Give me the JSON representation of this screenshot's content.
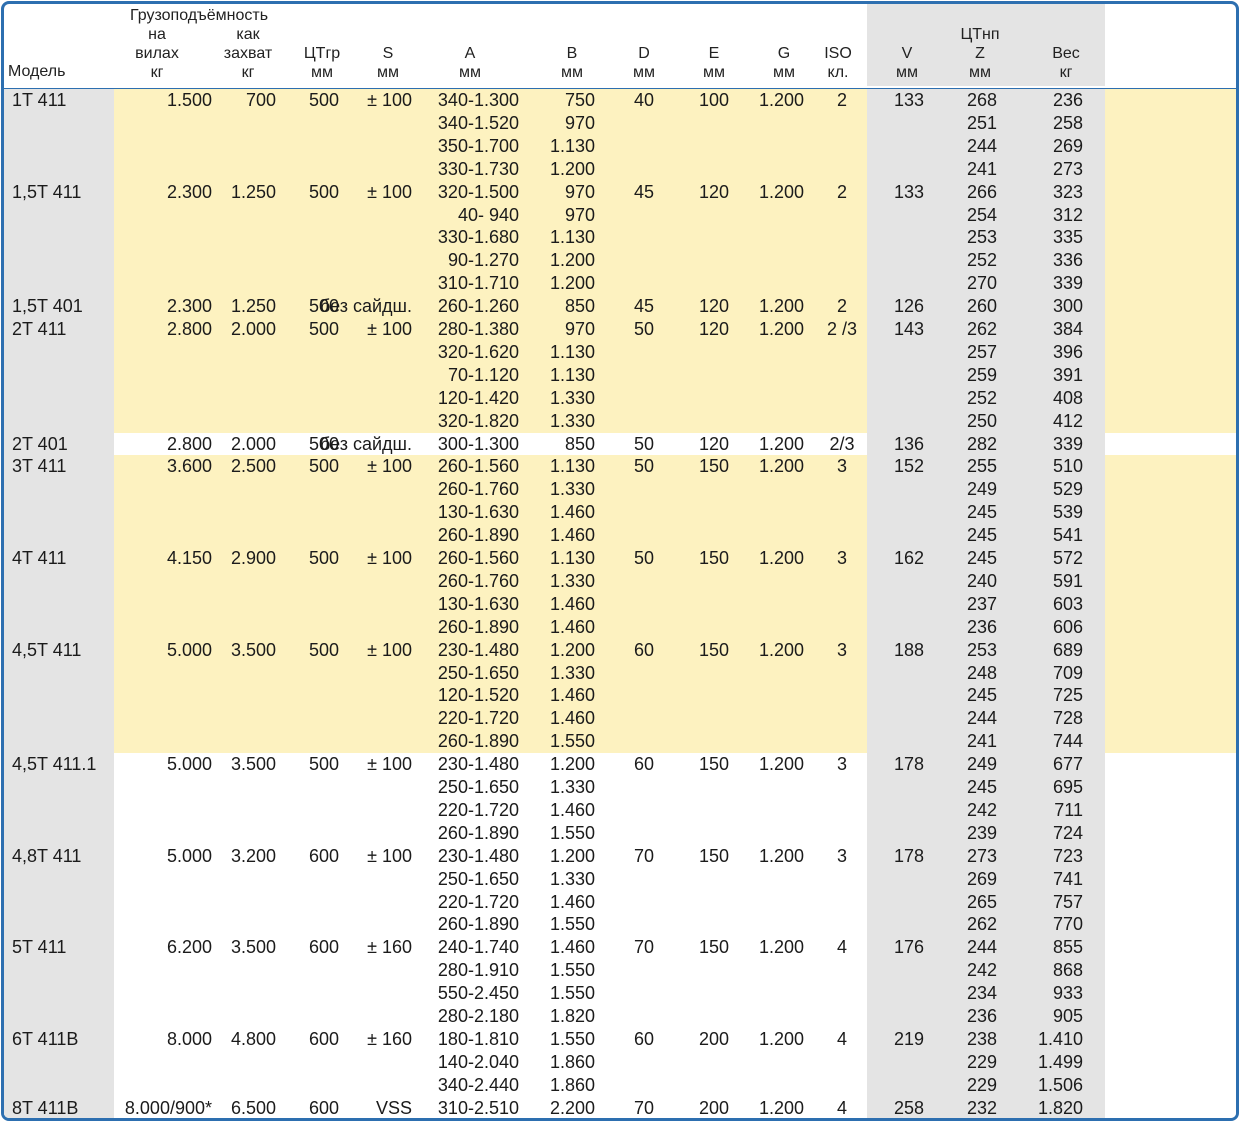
{
  "headers": {
    "model": "Модель",
    "capacity_group": "Грузоподъёмность",
    "forks": [
      "на",
      "вилах",
      "кг"
    ],
    "clamp": [
      "как",
      "захват",
      "кг"
    ],
    "ctgr": [
      "ЦТгр",
      "мм"
    ],
    "s": [
      "S",
      "мм"
    ],
    "a": [
      "A",
      "мм"
    ],
    "b": [
      "B",
      "мм"
    ],
    "d": [
      "D",
      "мм"
    ],
    "e": [
      "E",
      "мм"
    ],
    "g": [
      "G",
      "мм"
    ],
    "iso": [
      "ISO",
      "кл."
    ],
    "v": [
      "V",
      "мм"
    ],
    "z": [
      "ЦТнп",
      "Z",
      "мм"
    ],
    "weight": [
      "Вес",
      "кг"
    ]
  },
  "groups": [
    {
      "bg": "yellow",
      "rows": [
        {
          "model": "1T 411",
          "forks": "1.500",
          "clamp": "700",
          "ctgr": "500",
          "s": "± 100",
          "a": "340-1.300",
          "b": "750",
          "d": "40",
          "e": "100",
          "g": "1.200",
          "iso": "2",
          "v": "133",
          "z": "268",
          "w": "236"
        },
        {
          "a": "340-1.520",
          "b": "970",
          "z": "251",
          "w": "258"
        },
        {
          "a": "350-1.700",
          "b": "1.130",
          "z": "244",
          "w": "269"
        },
        {
          "a": "330-1.730",
          "b": "1.200",
          "z": "241",
          "w": "273"
        }
      ]
    },
    {
      "bg": "yellow",
      "rows": [
        {
          "model": "1,5T 411",
          "forks": "2.300",
          "clamp": "1.250",
          "ctgr": "500",
          "s": "± 100",
          "a": "320-1.500",
          "b": "970",
          "d": "45",
          "e": "120",
          "g": "1.200",
          "iso": "2",
          "v": "133",
          "z": "266",
          "w": "323"
        },
        {
          "a": "40- 940",
          "b": "970",
          "z": "254",
          "w": "312"
        },
        {
          "a": "330-1.680",
          "b": "1.130",
          "z": "253",
          "w": "335"
        },
        {
          "a": "90-1.270",
          "b": "1.200",
          "z": "252",
          "w": "336"
        },
        {
          "a": "310-1.710",
          "b": "1.200",
          "z": "270",
          "w": "339"
        },
        {
          "model": "1,5T 401",
          "forks": "2.300",
          "clamp": "1.250",
          "ctgr": "500",
          "s": "без сайдш.",
          "a": "260-1.260",
          "b": "850",
          "d": "45",
          "e": "120",
          "g": "1.200",
          "iso": "2",
          "v": "126",
          "z": "260",
          "w": "300"
        }
      ]
    },
    {
      "bg": "yellow",
      "rows": [
        {
          "model": "2T 411",
          "forks": "2.800",
          "clamp": "2.000",
          "ctgr": "500",
          "s": "± 100",
          "a": "280-1.380",
          "b": "970",
          "d": "50",
          "e": "120",
          "g": "1.200",
          "iso": "2 /3",
          "v": "143",
          "z": "262",
          "w": "384"
        },
        {
          "a": "320-1.620",
          "b": "1.130",
          "z": "257",
          "w": "396"
        },
        {
          "a": "70-1.120",
          "b": "1.130",
          "z": "259",
          "w": "391"
        },
        {
          "a": "120-1.420",
          "b": "1.330",
          "z": "252",
          "w": "408"
        },
        {
          "a": "320-1.820",
          "b": "1.330",
          "z": "250",
          "w": "412"
        }
      ]
    },
    {
      "bg": "white",
      "rows": [
        {
          "model": "2T 401",
          "forks": "2.800",
          "clamp": "2.000",
          "ctgr": "500",
          "s": "без сайдш.",
          "a": "300-1.300",
          "b": "850",
          "d": "50",
          "e": "120",
          "g": "1.200",
          "iso": "2/3",
          "v": "136",
          "z": "282",
          "w": "339"
        }
      ]
    },
    {
      "bg": "yellow",
      "rows": [
        {
          "model": "3T 411",
          "forks": "3.600",
          "clamp": "2.500",
          "ctgr": "500",
          "s": "± 100",
          "a": "260-1.560",
          "b": "1.130",
          "d": "50",
          "e": "150",
          "g": "1.200",
          "iso": "3",
          "v": "152",
          "z": "255",
          "w": "510"
        },
        {
          "a": "260-1.760",
          "b": "1.330",
          "z": "249",
          "w": "529"
        },
        {
          "a": "130-1.630",
          "b": "1.460",
          "z": "245",
          "w": "539"
        },
        {
          "a": "260-1.890",
          "b": "1.460",
          "z": "245",
          "w": "541"
        }
      ]
    },
    {
      "bg": "yellow",
      "rows": [
        {
          "model": "4T 411",
          "forks": "4.150",
          "clamp": "2.900",
          "ctgr": "500",
          "s": "± 100",
          "a": "260-1.560",
          "b": "1.130",
          "d": "50",
          "e": "150",
          "g": "1.200",
          "iso": "3",
          "v": "162",
          "z": "245",
          "w": "572"
        },
        {
          "a": "260-1.760",
          "b": "1.330",
          "z": "240",
          "w": "591"
        },
        {
          "a": "130-1.630",
          "b": "1.460",
          "z": "237",
          "w": "603"
        },
        {
          "a": "260-1.890",
          "b": "1.460",
          "z": "236",
          "w": "606"
        }
      ]
    },
    {
      "bg": "yellow",
      "rows": [
        {
          "model": "4,5T 411",
          "forks": "5.000",
          "clamp": "3.500",
          "ctgr": "500",
          "s": "± 100",
          "a": "230-1.480",
          "b": "1.200",
          "d": "60",
          "e": "150",
          "g": "1.200",
          "iso": "3",
          "v": "188",
          "z": "253",
          "w": "689"
        },
        {
          "a": "250-1.650",
          "b": "1.330",
          "z": "248",
          "w": "709"
        },
        {
          "a": "120-1.520",
          "b": "1.460",
          "z": "245",
          "w": "725"
        },
        {
          "a": "220-1.720",
          "b": "1.460",
          "z": "244",
          "w": "728"
        },
        {
          "a": "260-1.890",
          "b": "1.550",
          "z": "241",
          "w": "744"
        }
      ]
    },
    {
      "bg": "white",
      "rows": [
        {
          "model": "4,5T 411.1",
          "forks": "5.000",
          "clamp": "3.500",
          "ctgr": "500",
          "s": "± 100",
          "a": "230-1.480",
          "b": "1.200",
          "d": "60",
          "e": "150",
          "g": "1.200",
          "iso": "3",
          "v": "178",
          "z": "249",
          "w": "677"
        },
        {
          "a": "250-1.650",
          "b": "1.330",
          "z": "245",
          "w": "695"
        },
        {
          "a": "220-1.720",
          "b": "1.460",
          "z": "242",
          "w": "711"
        },
        {
          "a": "260-1.890",
          "b": "1.550",
          "z": "239",
          "w": "724"
        }
      ]
    },
    {
      "bg": "white",
      "rows": [
        {
          "model": "4,8T 411",
          "forks": "5.000",
          "clamp": "3.200",
          "ctgr": "600",
          "s": "± 100",
          "a": "230-1.480",
          "b": "1.200",
          "d": "70",
          "e": "150",
          "g": "1.200",
          "iso": "3",
          "v": "178",
          "z": "273",
          "w": "723"
        },
        {
          "a": "250-1.650",
          "b": "1.330",
          "z": "269",
          "w": "741"
        },
        {
          "a": "220-1.720",
          "b": "1.460",
          "z": "265",
          "w": "757"
        },
        {
          "a": "260-1.890",
          "b": "1.550",
          "z": "262",
          "w": "770"
        }
      ]
    },
    {
      "bg": "white",
      "rows": [
        {
          "model": "5T 411",
          "forks": "6.200",
          "clamp": "3.500",
          "ctgr": "600",
          "s": "± 160",
          "a": "240-1.740",
          "b": "1.460",
          "d": "70",
          "e": "150",
          "g": "1.200",
          "iso": "4",
          "v": "176",
          "z": "244",
          "w": "855"
        },
        {
          "a": "280-1.910",
          "b": "1.550",
          "z": "242",
          "w": "868"
        },
        {
          "a": "550-2.450",
          "b": "1.550",
          "z": "234",
          "w": "933"
        },
        {
          "a": "280-2.180",
          "b": "1.820",
          "z": "236",
          "w": "905"
        }
      ]
    },
    {
      "bg": "white",
      "rows": [
        {
          "model": "6T 411B",
          "forks": "8.000",
          "clamp": "4.800",
          "ctgr": "600",
          "s": "± 160",
          "a": "180-1.810",
          "b": "1.550",
          "d": "60",
          "e": "200",
          "g": "1.200",
          "iso": "4",
          "v": "219",
          "z": "238",
          "w": "1.410"
        },
        {
          "a": "140-2.040",
          "b": "1.860",
          "z": "229",
          "w": "1.499"
        },
        {
          "a": "340-2.440",
          "b": "1.860",
          "z": "229",
          "w": "1.506"
        }
      ]
    },
    {
      "bg": "white",
      "rows": [
        {
          "model": "8T 411B",
          "forks": "8.000/900*",
          "clamp": "6.500",
          "ctgr": "600",
          "s": "VSS",
          "a": "310-2.510",
          "b": "2.200",
          "d": "70",
          "e": "200",
          "g": "1.200",
          "iso": "4",
          "v": "258",
          "z": "232",
          "w": "1.820"
        }
      ]
    }
  ]
}
